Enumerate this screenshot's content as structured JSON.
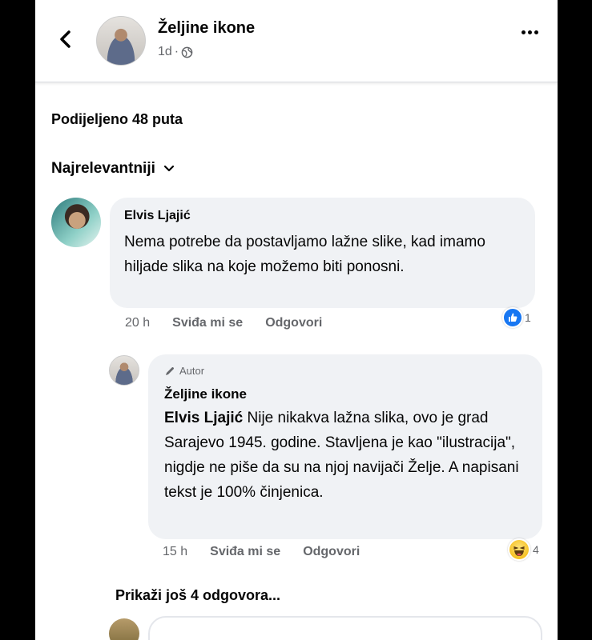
{
  "header": {
    "page_name": "Željine ikone",
    "time": "1d",
    "separator": "·"
  },
  "shared_text": "Podijeljeno 48 puta",
  "sort_label": "Najrelevantniji",
  "comments": [
    {
      "author": "Elvis Ljajić",
      "text": "Nema potrebe da postavljamo lažne slike, kad imamo hiljade slika na koje možemo biti ponosni.",
      "time": "20 h",
      "like_label": "Sviđa mi se",
      "reply_label": "Odgovori",
      "reaction": "like-icon",
      "reaction_count": "1"
    }
  ],
  "reply": {
    "badge_label": "Autor",
    "author": "Željine ikone",
    "mention": "Elvis Ljajić",
    "text": " Nije nikakva lažna slika, ovo je grad Sarajevo 1945. godine. Stavljena je kao \"ilustracija\", nigdje ne piše da su na njoj navijači Želje. A napisani tekst je 100% činjenica.",
    "time": "15 h",
    "like_label": "Sviđa mi se",
    "reply_label": "Odgovori",
    "reaction": "haha-icon",
    "reaction_count": "4"
  },
  "more_replies_label": "Prikaži još 4 odgovora...",
  "colors": {
    "like_blue": "#1877f2",
    "bubble_bg": "#f0f2f5",
    "secondary_text": "#65676b"
  }
}
